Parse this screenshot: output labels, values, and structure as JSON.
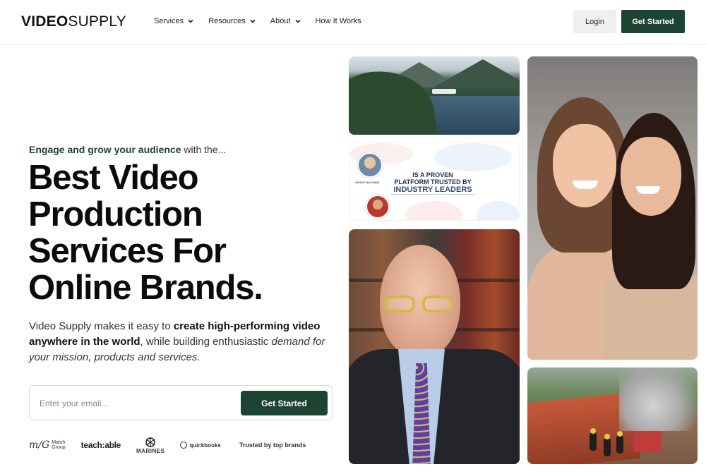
{
  "header": {
    "logo_bold": "VIDEO",
    "logo_light": "SUPPLY",
    "nav": [
      {
        "label": "Services",
        "has_dropdown": true
      },
      {
        "label": "Resources",
        "has_dropdown": true
      },
      {
        "label": "About",
        "has_dropdown": true
      },
      {
        "label": "How It Works",
        "has_dropdown": false
      }
    ],
    "login_label": "Login",
    "cta_label": "Get Started"
  },
  "hero": {
    "eyebrow_strong": "Engage and grow your audience",
    "eyebrow_rest": " with the...",
    "headline_lines": [
      "Best Video",
      "Production",
      "Services For",
      "Online Brands."
    ],
    "subcopy": {
      "p1": "Video Supply makes it easy to ",
      "b1": "create high-performing video anywhere in the world",
      "p2": ", while building enthusiastic ",
      "i1": "demand for your mission, products and services."
    },
    "email_placeholder": "Enter your email...",
    "email_cta_label": "Get Started"
  },
  "brands": {
    "match_mark": "m/G",
    "match_line1": "Match",
    "match_line2": "Group",
    "teachable": "teach:able",
    "marines": "MARINES",
    "quickbooks": "quickbooks",
    "trusted": "Trusted by top brands"
  },
  "media": {
    "trust_line1": "IS A PROVEN",
    "trust_line2": "PLATFORM TRUSTED BY",
    "trust_line3": "INDUSTRY LEADERS",
    "avatar_caption": "GRANT BALDWIN"
  },
  "colors": {
    "brand_green": "#1d4432",
    "login_bg": "#efefef",
    "tie_purple": "#5b3fb0",
    "glasses_yellow": "#d9b64a"
  }
}
